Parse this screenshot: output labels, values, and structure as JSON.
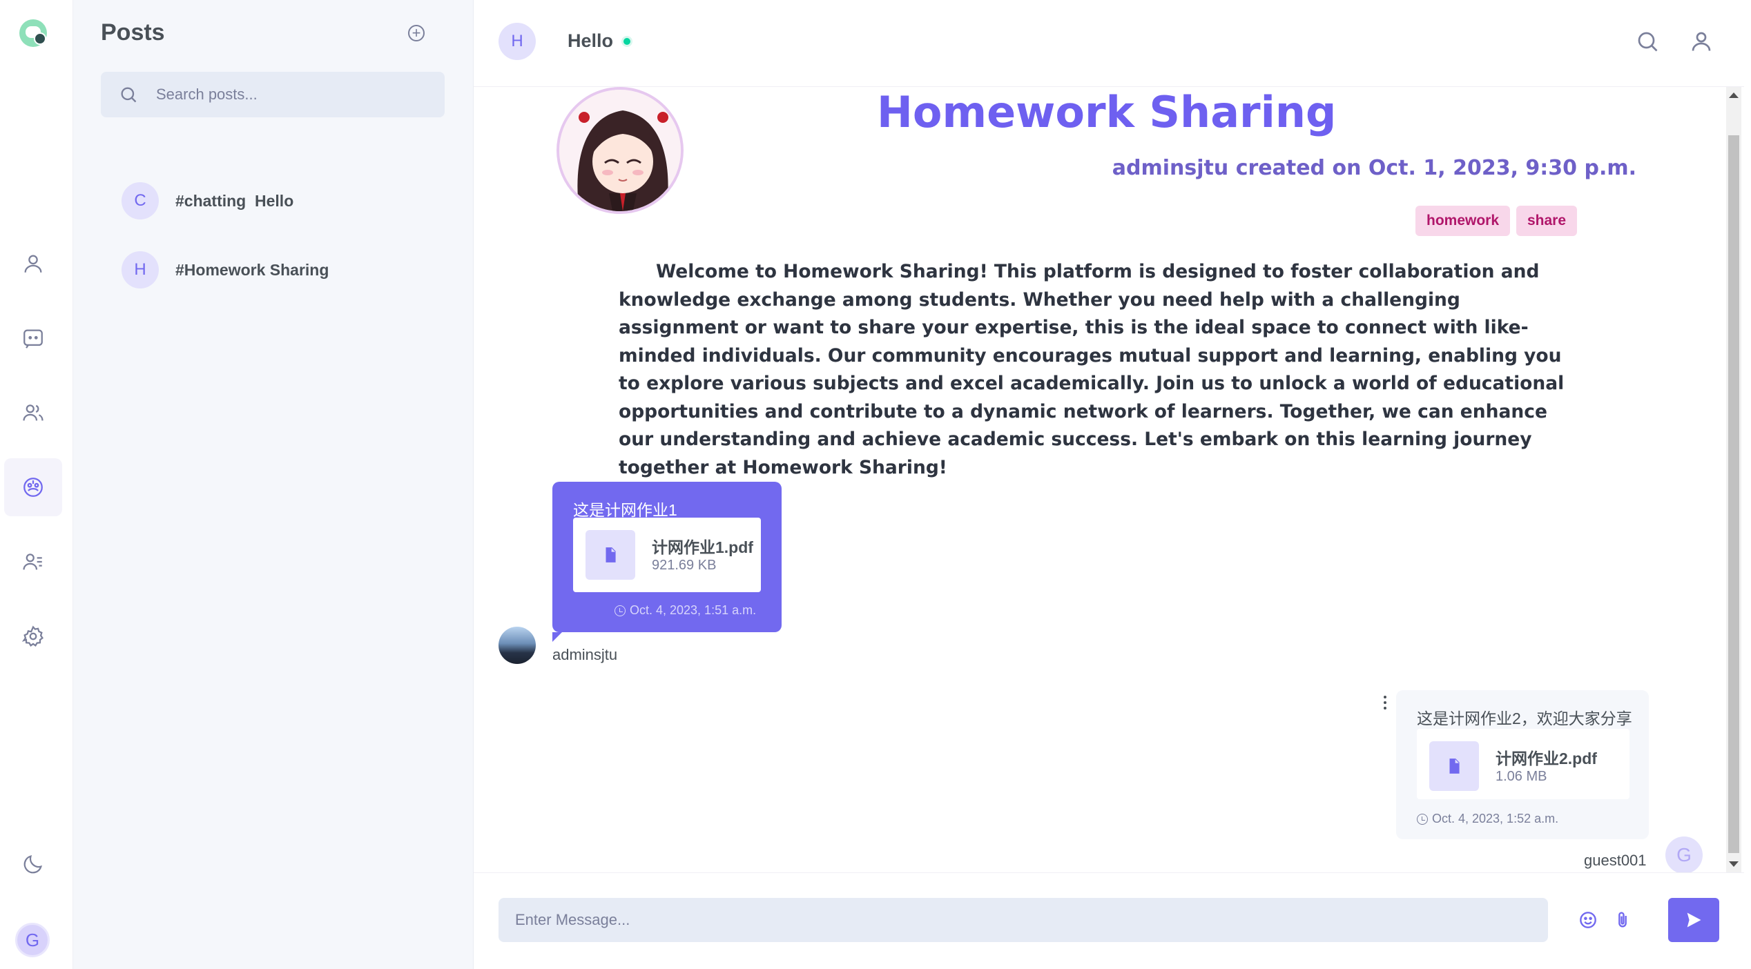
{
  "sidebar": {
    "title": "Posts",
    "search_placeholder": "Search posts...",
    "posts": [
      {
        "avatar_letter": "C",
        "name": "#chatting  Hello"
      },
      {
        "avatar_letter": "H",
        "name": "#Homework Sharing"
      }
    ]
  },
  "rail": {
    "active_item": "posts",
    "user_avatar_letter": "G"
  },
  "header": {
    "avatar_letter": "H",
    "name": "Hello",
    "status_color": "#06d6a0"
  },
  "post": {
    "title": "Homework Sharing",
    "meta": "adminsjtu created on Oct. 1, 2023, 9:30 p.m.",
    "tags": [
      "homework",
      "share"
    ],
    "body": "Welcome to Homework Sharing! This platform is designed to foster collaboration and knowledge exchange among students. Whether you need help with a challenging assignment or want to share your expertise, this is the ideal space to connect with like-minded individuals. Our community encourages mutual support and learning, enabling you to explore various subjects and excel academically. Join us to unlock a world of educational opportunities and contribute to a dynamic network of learners. Together, we can enhance our understanding and achieve academic success. Let's embark on this learning journey together at Homework Sharing!"
  },
  "messages": [
    {
      "user": "adminsjtu",
      "text": "这是计网作业1",
      "file_name": "计网作业1.pdf",
      "file_size": "921.69 KB",
      "time": "Oct. 4, 2023, 1:51 a.m."
    },
    {
      "user": "guest001",
      "avatar_letter": "G",
      "text": "这是计网作业2，欢迎大家分享",
      "file_name": "计网作业2.pdf",
      "file_size": "1.06 MB",
      "time": "Oct. 4, 2023, 1:52 a.m."
    }
  ],
  "input": {
    "placeholder": "Enter Message..."
  },
  "colors": {
    "accent": "#7269ef",
    "tag_bg": "#f8d7ea",
    "tag_text": "#b0166a",
    "online": "#06d6a0"
  }
}
